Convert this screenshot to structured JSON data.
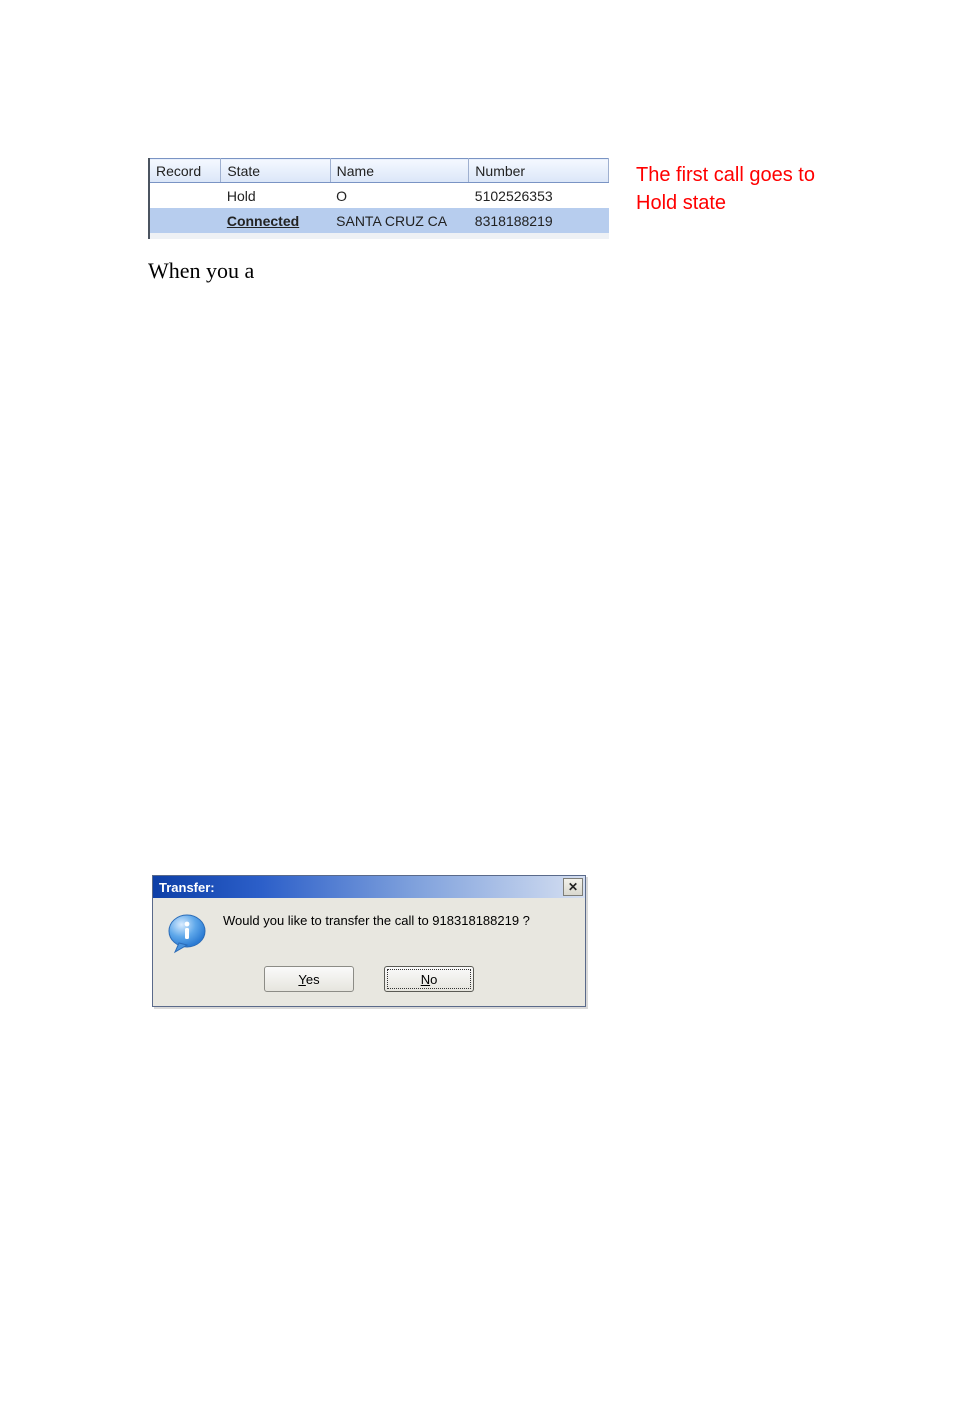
{
  "call_table": {
    "headers": {
      "record": "Record",
      "state": "State",
      "name": "Name",
      "number": "Number"
    },
    "rows": [
      {
        "record": "",
        "state": "Hold",
        "name": "O",
        "number": "5102526353",
        "state_class": ""
      },
      {
        "record": "",
        "state": "Connected",
        "name": "SANTA CRUZ  CA",
        "number": "8318188219",
        "state_class": "state-connected"
      }
    ]
  },
  "annotation": "The first call goes to Hold state",
  "body_text": "When you a",
  "dialog": {
    "title": "Transfer:",
    "message": "Would you like to transfer the call to 918318188219 ?",
    "yes": "Yes",
    "no": "No",
    "close_glyph": "✕"
  }
}
